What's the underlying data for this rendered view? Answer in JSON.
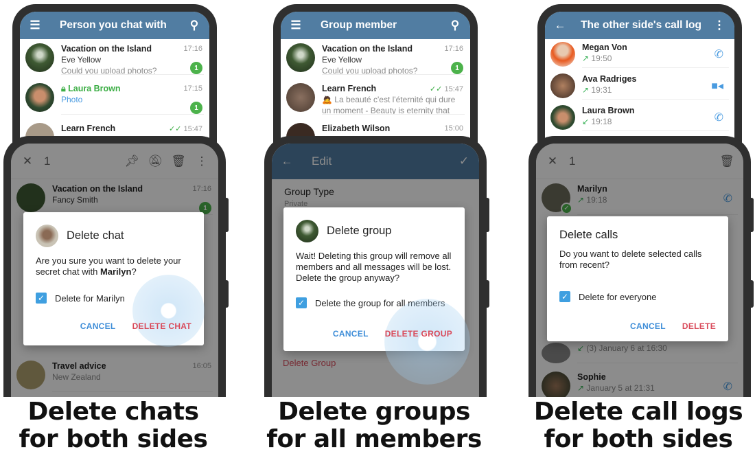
{
  "colors": {
    "header": "#517da2",
    "accent": "#3f9fe0",
    "danger": "#d94a5a",
    "unread": "#4cb24b"
  },
  "panel1": {
    "back": {
      "title": "Person you chat with",
      "menu_icon": "menu-icon",
      "search_icon": "search-icon",
      "chats": [
        {
          "name": "Vacation on the Island",
          "sender": "Eve Yellow",
          "message": "Could you upload photos?",
          "time": "17:16",
          "unread": "1"
        },
        {
          "name": "Laura Brown",
          "message": "Photo",
          "time": "17:15",
          "unread": "1",
          "secret": true
        },
        {
          "name": "Learn French",
          "time": "15:47"
        }
      ]
    },
    "front": {
      "count": "1",
      "chats": [
        {
          "name": "Vacation on the Island",
          "sender": "Fancy Smith",
          "time": "17:16",
          "unread": "1"
        },
        {
          "name": "Travel advice",
          "message": "New Zealand",
          "time": "16:05"
        }
      ],
      "dialog": {
        "title": "Delete chat",
        "text_prefix": "Are you sure you want to delete your secret chat with ",
        "text_name": "Marilyn",
        "text_suffix": "?",
        "checkbox": "Delete for Marilyn",
        "checked": true,
        "cancel": "CANCEL",
        "confirm": "DELETE CHAT"
      }
    },
    "caption": [
      "Delete chats",
      "for both sides"
    ]
  },
  "panel2": {
    "back": {
      "title": "Group member",
      "chats": [
        {
          "name": "Vacation on the Island",
          "sender": "Eve Yellow",
          "message": "Could you upload photos?",
          "time": "17:16",
          "unread": "1"
        },
        {
          "name": "Learn French",
          "message": "🙇 La beauté c'est l'éternité qui dure un moment - Beauty is eternity that last...",
          "time": "15:47"
        },
        {
          "name": "Elizabeth Wilson",
          "time": "15:00"
        }
      ]
    },
    "front": {
      "title": "Edit",
      "group_type_label": "Group Type",
      "group_type_value": "Private",
      "delete_group": "Delete Group",
      "dialog": {
        "title": "Delete group",
        "text": "Wait! Deleting this group will remove all members and all messages will be lost. Delete the group anyway?",
        "checkbox": "Delete the group for all members",
        "checked": true,
        "cancel": "CANCEL",
        "confirm": "DELETE GROUP"
      }
    },
    "caption": [
      "Delete groups",
      "for all members"
    ]
  },
  "panel3": {
    "back": {
      "title": "The other side's call log",
      "calls": [
        {
          "name": "Megan Von",
          "time": "19:50",
          "direction": "outgoing",
          "type": "voice"
        },
        {
          "name": "Ava Radriges",
          "time": "19:31",
          "direction": "outgoing",
          "type": "video"
        },
        {
          "name": "Laura Brown",
          "time": "19:18",
          "direction": "incoming",
          "type": "voice"
        }
      ]
    },
    "front": {
      "count": "1",
      "calls": [
        {
          "name": "Marilyn",
          "time": "19:18"
        },
        {
          "name": "",
          "time": "(3) January 6 at 16:30"
        },
        {
          "name": "Sophie",
          "time": "January 5 at 21:31"
        }
      ],
      "dialog": {
        "title": "Delete calls",
        "text": "Do you want to delete selected calls from recent?",
        "checkbox": "Delete for everyone",
        "checked": true,
        "cancel": "CANCEL",
        "confirm": "DELETE"
      }
    },
    "caption": [
      "Delete call logs",
      "for both sides"
    ]
  }
}
